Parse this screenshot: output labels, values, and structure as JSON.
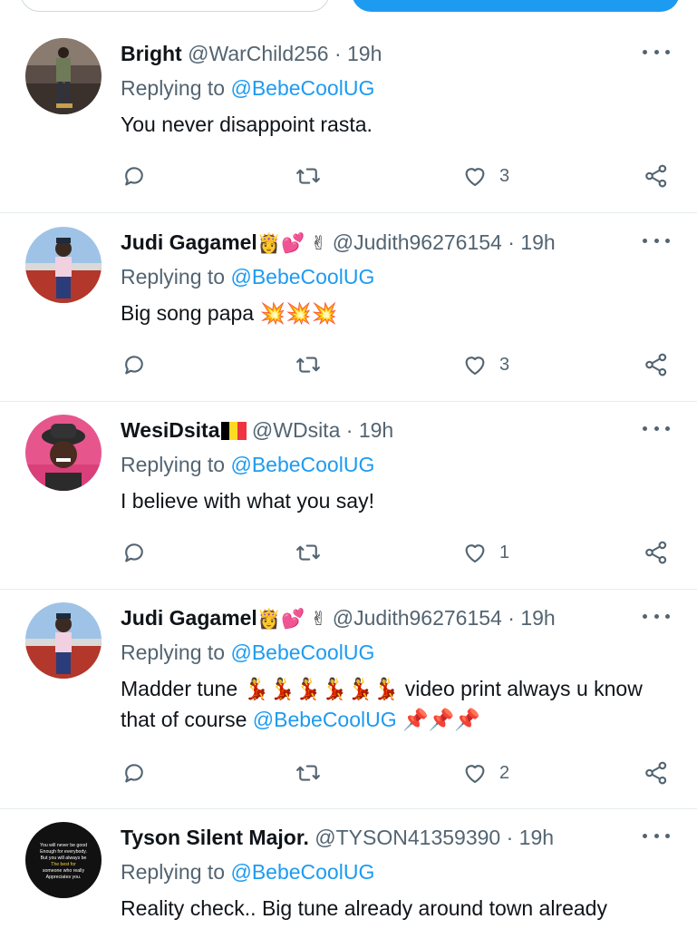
{
  "colors": {
    "accent": "#1d9bf0",
    "text_primary": "#0f1419",
    "text_secondary": "#536471",
    "divider": "#e6ecf0"
  },
  "tweets": [
    {
      "name": "Bright",
      "name_emoji": "",
      "handle": "@WarChild256",
      "separator": "·",
      "time": "19h",
      "reply_prefix": "Replying to",
      "reply_to": "@BebeCoolUG",
      "text": "You never disappoint rasta.",
      "text_mention": "",
      "text_suffix": "",
      "likes": "3"
    },
    {
      "name": "Judi Gagamel",
      "name_emoji": "👸💕 ✌",
      "handle": "@Judith96276154",
      "separator": "·",
      "time": "19h",
      "reply_prefix": "Replying to",
      "reply_to": "@BebeCoolUG",
      "text": "Big song papa 💥💥💥",
      "text_mention": "",
      "text_suffix": "",
      "likes": "3"
    },
    {
      "name": "WesiDsita",
      "name_emoji": "",
      "handle": "@WDsita",
      "separator": "·",
      "time": "19h",
      "reply_prefix": "Replying to",
      "reply_to": "@BebeCoolUG",
      "text": "I believe with what you say!",
      "text_mention": "",
      "text_suffix": "",
      "likes": "1"
    },
    {
      "name": "Judi Gagamel",
      "name_emoji": "👸💕 ✌",
      "handle": "@Judith96276154",
      "separator": "·",
      "time": "19h",
      "reply_prefix": "Replying to",
      "reply_to": "@BebeCoolUG",
      "text": "Madder tune  💃💃💃💃💃💃 video print always u know that of course ",
      "text_mention": "@BebeCoolUG",
      "text_suffix": " 📌📌📌",
      "likes": "2"
    },
    {
      "name": "Tyson Silent Major.",
      "name_emoji": "",
      "handle": "@TYSON41359390",
      "separator": "·",
      "time": "19h",
      "reply_prefix": "Replying to",
      "reply_to": "@BebeCoolUG",
      "text": "Reality check.. Big tune already around town already",
      "text_mention": "",
      "text_suffix": "",
      "likes": ""
    }
  ],
  "avatar_text": {
    "line1": "You will never be good",
    "line2": "Enough for everybody.",
    "line3": "But you will always be",
    "line4": "The best for",
    "line5": "someone who really",
    "line6": "Appreciates you."
  },
  "icons": {
    "reply": "reply-icon",
    "retweet": "retweet-icon",
    "like": "heart-icon",
    "share": "share-icon",
    "more": "more-icon"
  }
}
